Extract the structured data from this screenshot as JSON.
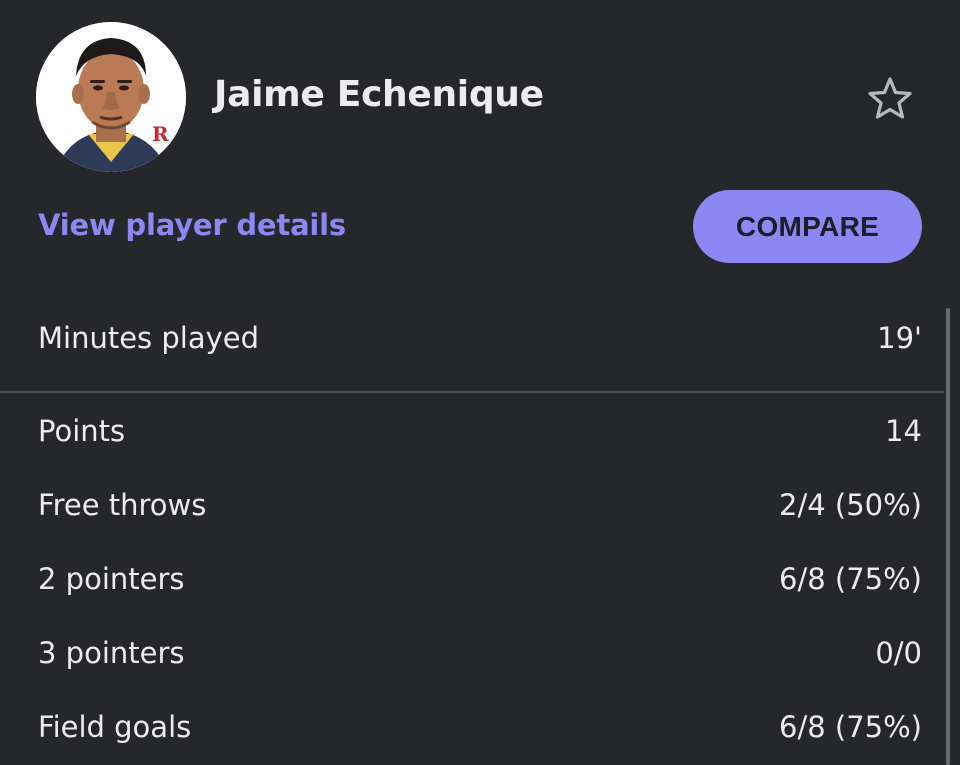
{
  "player": {
    "name": "Jaime Echenique",
    "view_details_label": "View player details",
    "compare_label": "COMPARE",
    "favorite_icon": "star-outline-icon",
    "avatar_badge_text": "R"
  },
  "stats": {
    "minutes": {
      "label": "Minutes played",
      "value": "19'"
    },
    "rows": [
      {
        "label": "Points",
        "value": "14"
      },
      {
        "label": "Free throws",
        "value": "2/4 (50%)"
      },
      {
        "label": "2 pointers",
        "value": "6/8 (75%)"
      },
      {
        "label": "3 pointers",
        "value": "0/0"
      },
      {
        "label": "Field goals",
        "value": "6/8 (75%)"
      }
    ]
  },
  "colors": {
    "background": "#26272b",
    "accent": "#8c87f2",
    "text": "#ececee",
    "divider": "#4a4b50"
  }
}
